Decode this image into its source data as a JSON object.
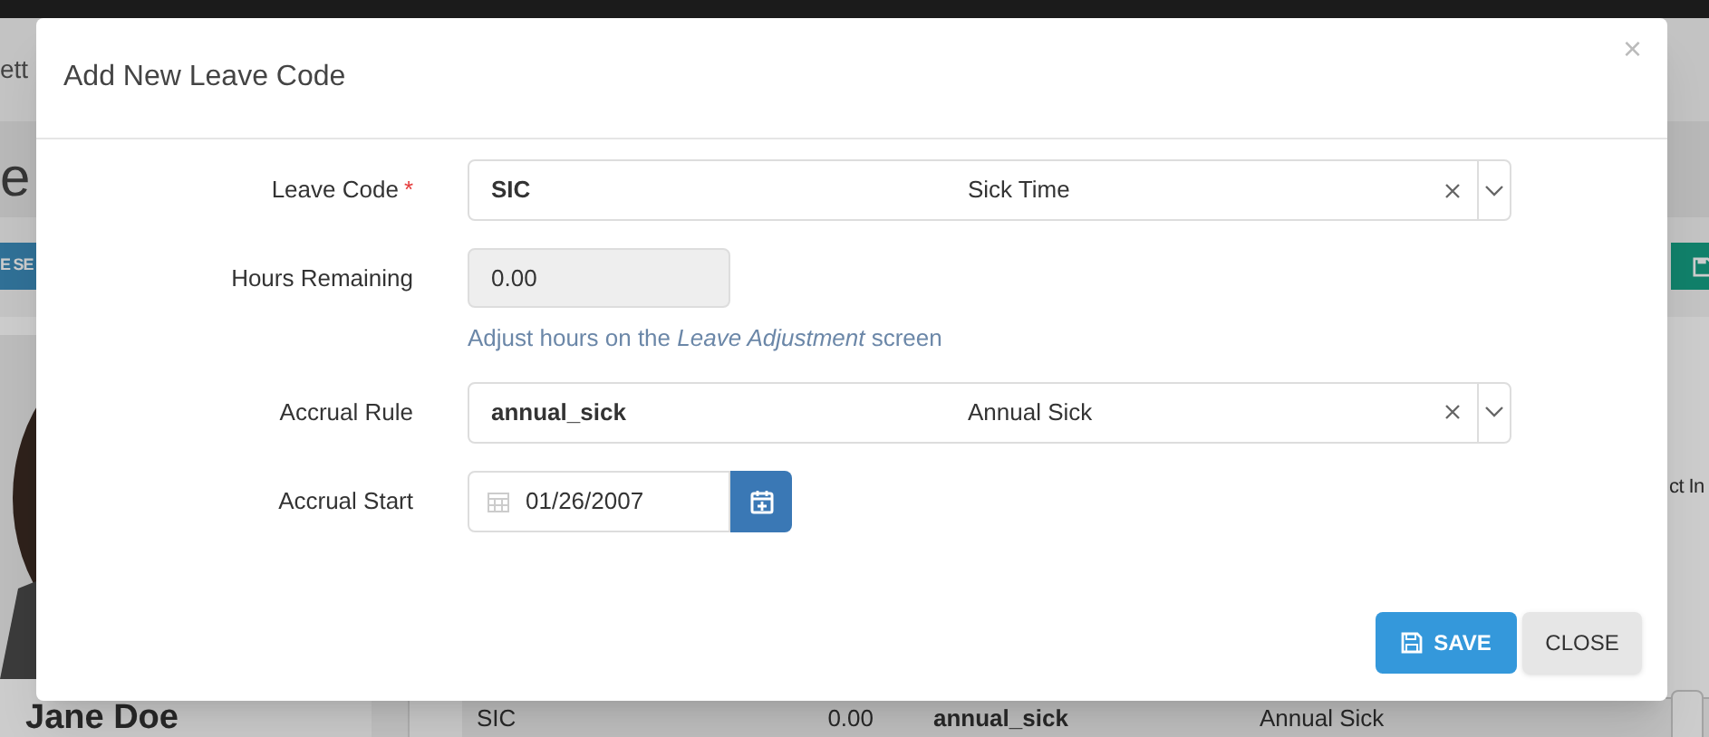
{
  "background": {
    "breadcrumb": "ett",
    "page_title": "e",
    "search_button": "E SE",
    "profile": {
      "name": "Jane Doe"
    },
    "column_header": "ct In",
    "table_row": [
      "SIC",
      "0.00",
      "annual_sick",
      "Annual Sick"
    ]
  },
  "modal": {
    "title": "Add New Leave Code",
    "close_glyph": "×",
    "fields": [
      {
        "kind": "select",
        "label": "Leave Code",
        "required_mark": "*",
        "value": "SIC",
        "description": "Sick Time"
      },
      {
        "kind": "readonly",
        "label": "Hours Remaining",
        "value": "0.00",
        "help": "Adjust hours on the *Leave Adjustment* screen"
      },
      {
        "kind": "select",
        "label": "Accrual Rule",
        "value": "annual_sick",
        "description": "Annual Sick"
      },
      {
        "kind": "date",
        "label": "Accrual Start",
        "value": "01/26/2007"
      }
    ],
    "buttons": [
      {
        "kind": "primary",
        "label": "SAVE"
      },
      {
        "kind": "default",
        "label": "CLOSE"
      }
    ]
  }
}
